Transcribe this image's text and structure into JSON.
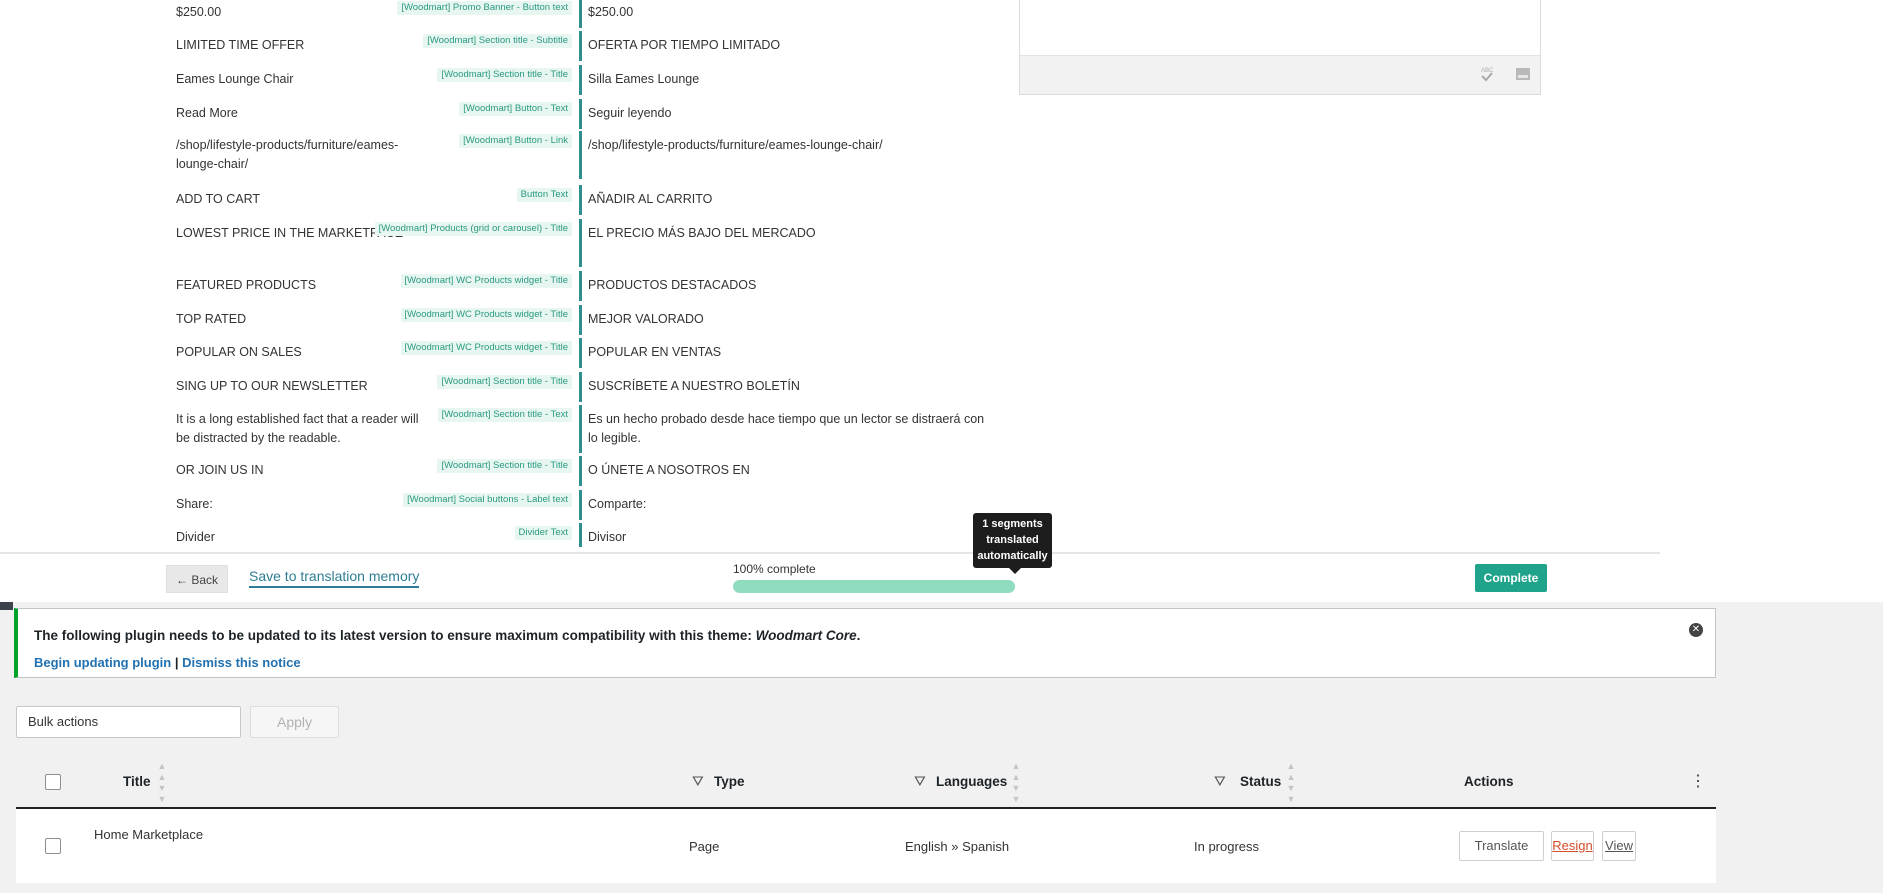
{
  "segments": [
    {
      "source": "$250.00",
      "tag": "[Woodmart] Promo Banner - Button text",
      "target": "$250.00"
    },
    {
      "source": "LIMITED TIME OFFER",
      "tag": "[Woodmart] Section title - Subtitle",
      "target": "OFERTA POR TIEMPO LIMITADO"
    },
    {
      "source": "Eames Lounge Chair",
      "tag": "[Woodmart] Section title - Title",
      "target": "Silla Eames Lounge"
    },
    {
      "source": "Read More",
      "tag": "[Woodmart] Button - Text",
      "target": "Seguir leyendo"
    },
    {
      "source": "/shop/lifestyle-products/furniture/eames-lounge-chair/",
      "tag": "[Woodmart] Button - Link",
      "target": "/shop/lifestyle-products/furniture/eames-lounge-chair/"
    },
    {
      "source": "ADD TO CART",
      "tag": "Button Text",
      "target": "AÑADIR AL CARRITO"
    },
    {
      "source": "LOWEST PRICE IN THE MARKETPACE",
      "tag": "[Woodmart] Products (grid or carousel) - Title",
      "target": "EL PRECIO MÁS BAJO DEL MERCADO"
    },
    {
      "source": "FEATURED PRODUCTS",
      "tag": "[Woodmart] WC Products widget - Title",
      "target": "PRODUCTOS DESTACADOS"
    },
    {
      "source": "TOP RATED",
      "tag": "[Woodmart] WC Products widget - Title",
      "target": "MEJOR VALORADO"
    },
    {
      "source": "POPULAR ON SALES",
      "tag": "[Woodmart] WC Products widget - Title",
      "target": "POPULAR EN VENTAS"
    },
    {
      "source": "SING UP TO OUR NEWSLETTER",
      "tag": "[Woodmart] Section title - Title",
      "target": "SUSCRÍBETE A NUESTRO BOLETÍN"
    },
    {
      "source": "It is a long established fact that a reader will be distracted by the readable.",
      "tag": "[Woodmart] Section title - Text",
      "target": "Es un hecho probado desde hace tiempo que un lector se distraerá con lo legible."
    },
    {
      "source": "OR JOIN US IN",
      "tag": "[Woodmart] Section title - Title",
      "target": "O ÚNETE A NOSOTROS EN"
    },
    {
      "source": "Share:",
      "tag": "[Woodmart] Social buttons - Label text",
      "target": "Comparte:"
    },
    {
      "source": "Divider",
      "tag": "Divider Text",
      "target": "Divisor"
    }
  ],
  "side_toolbar": {
    "spellcheck_icon": "spellcheck-icon",
    "image_icon": "image-icon"
  },
  "footer": {
    "back_label": "← Back",
    "save_tm_label": "Save to translation memory",
    "progress_label": "100% complete",
    "progress_fraction": 1.0,
    "complete_label": "Complete",
    "tooltip": "1 segments translated automatically"
  },
  "notice": {
    "text": "The following plugin needs to be updated to its latest version to ensure maximum compatibility with this theme: ",
    "plugin_name": "Woodmart Core",
    "period": ".",
    "link_update": "Begin updating plugin",
    "separator": "|",
    "link_dismiss": "Dismiss this notice"
  },
  "bulk": {
    "select_value": "Bulk actions",
    "apply_label": "Apply"
  },
  "table": {
    "headers": {
      "title": "Title",
      "type": "Type",
      "languages": "Languages",
      "status": "Status",
      "actions": "Actions"
    },
    "row": {
      "title": "Home Marketplace",
      "type": "Page",
      "languages": "English » Spanish",
      "status": "In progress",
      "translate_label": "Translate",
      "resign_label": "Resign",
      "view_label": "View"
    }
  },
  "colors": {
    "accent_green": "#1fa38a",
    "divider_teal": "#2f8f8f",
    "notice_green": "#00a32a",
    "resign_red": "#d44d2b"
  }
}
